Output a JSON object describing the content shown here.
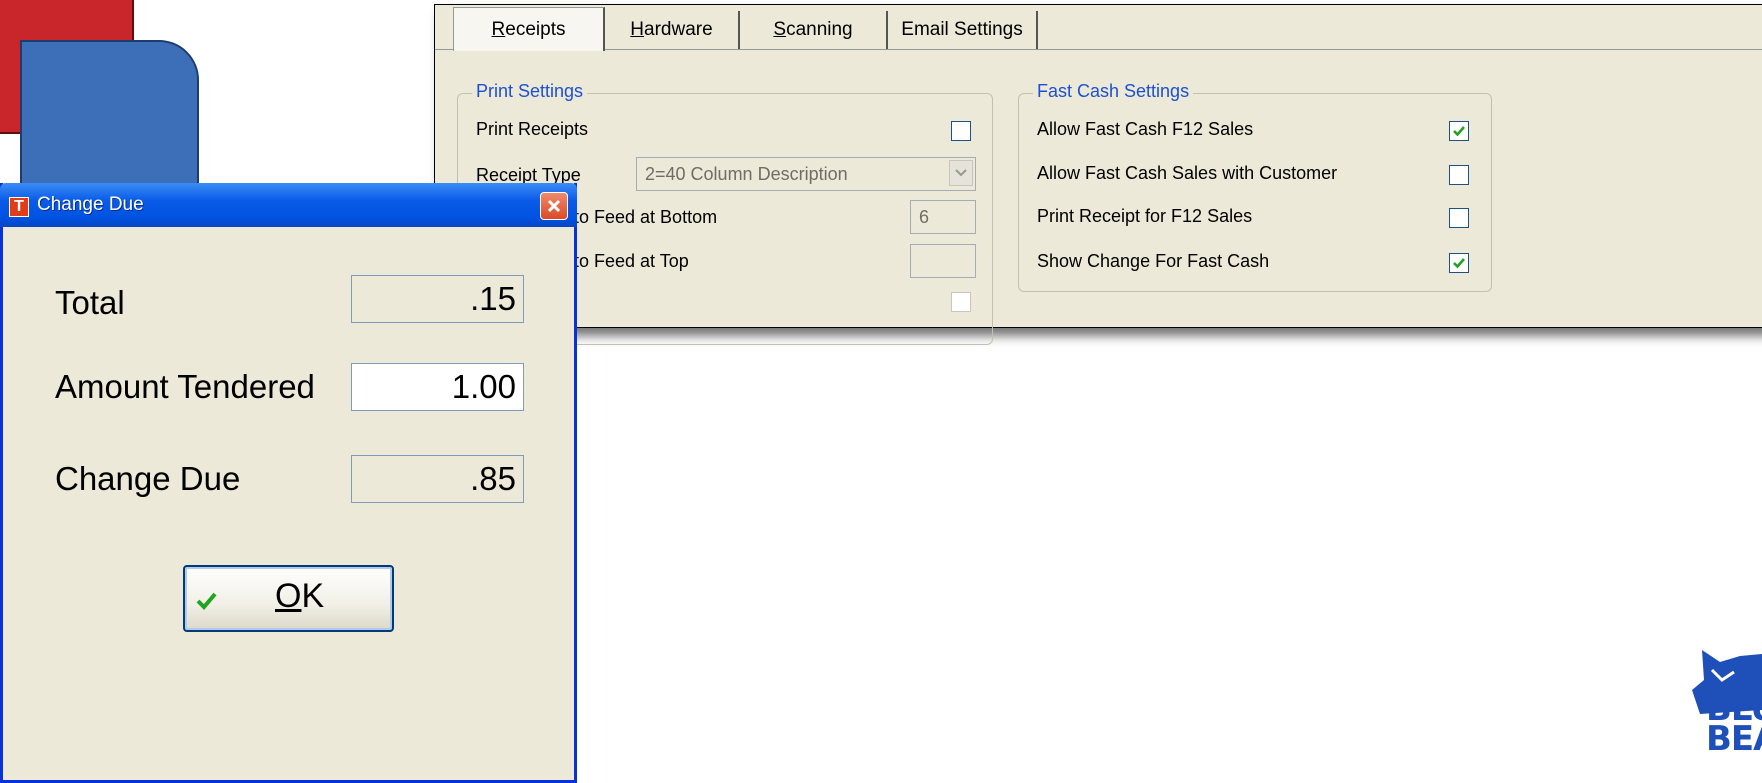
{
  "settings": {
    "tabs": [
      {
        "mnemonic": "R",
        "rest": "eceipts"
      },
      {
        "mnemonic": "H",
        "rest": "ardware"
      },
      {
        "mnemonic": "S",
        "rest": "canning"
      },
      {
        "mnemonic": "",
        "rest": "Email Settings"
      }
    ],
    "print_settings": {
      "legend": "Print Settings",
      "print_receipts_label": "Print Receipts",
      "print_receipts_checked": false,
      "receipt_type_label": "Receipt Type",
      "receipt_type_value": "2=40 Column Description",
      "feed_bottom_label": "to Feed at Bottom",
      "feed_bottom_value": "6",
      "feed_top_label": "to Feed at Top",
      "feed_top_value": ""
    },
    "fast_cash": {
      "legend": "Fast Cash Settings",
      "items": [
        {
          "label": "Allow Fast Cash F12 Sales",
          "checked": true
        },
        {
          "label": "Allow Fast Cash Sales with Customer",
          "checked": false
        },
        {
          "label": "Print Receipt for F12 Sales",
          "checked": false
        },
        {
          "label": "Show Change For Fast Cash",
          "checked": true
        }
      ]
    }
  },
  "dialog": {
    "title": "Change Due",
    "title_icon_letter": "T",
    "total_label": "Total",
    "total_value": ".15",
    "tendered_label": "Amount Tendered",
    "tendered_value": "1.00",
    "change_label": "Change Due",
    "change_value": ".85",
    "ok_mnemonic": "O",
    "ok_rest": "K"
  },
  "logo": {
    "text_line1": "BLU",
    "text_line2": "BEA"
  },
  "colors": {
    "legend_blue": "#1c50d0",
    "titlebar_blue": "#0052e0",
    "check_green": "#21a121"
  }
}
